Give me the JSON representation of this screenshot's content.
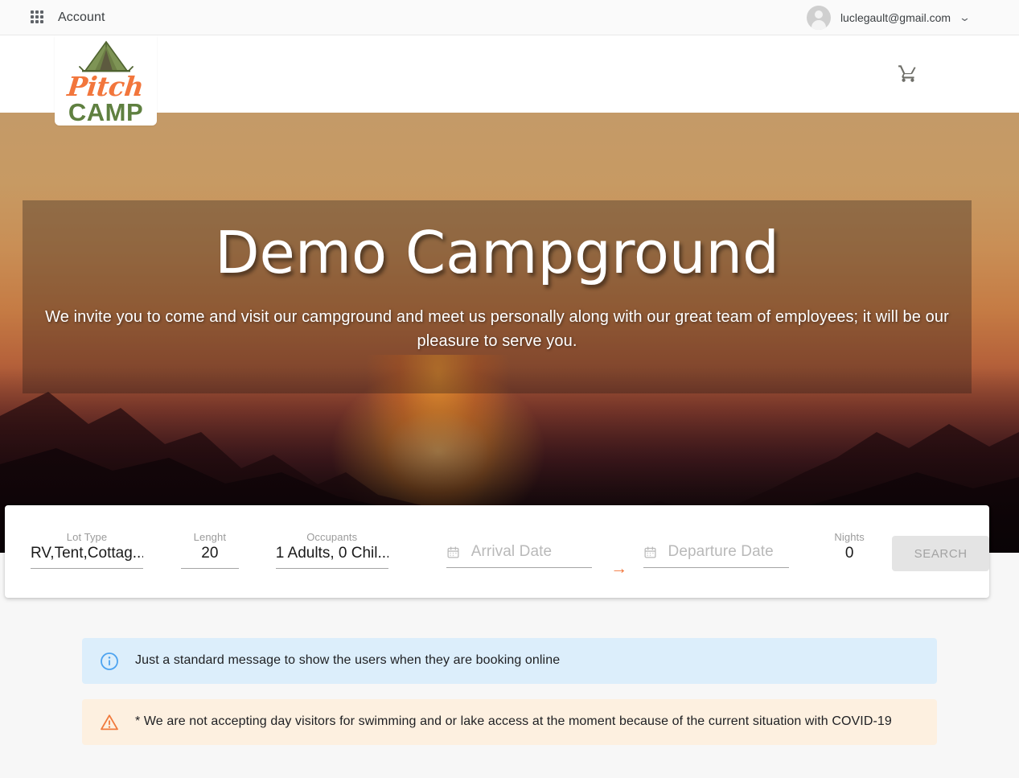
{
  "topbar": {
    "apps_icon": "apps-grid-icon",
    "account_label": "Account",
    "user_email": "luclegault@gmail.com",
    "chevron": "⌄"
  },
  "header": {
    "logo_pitch": "Pitch",
    "logo_camp": "CAMP",
    "logo_tent_icon": "tent-icon",
    "cart_icon": "shopping-cart-icon"
  },
  "hero": {
    "title": "Demo Campground",
    "subtitle": "We invite you to come and visit our campground and meet us personally along with our great team of employees; it will be our pleasure to serve you."
  },
  "search": {
    "lot_type": {
      "label": "Lot Type",
      "value": "RV,Tent,Cottag..."
    },
    "length": {
      "label": "Lenght",
      "value": "20"
    },
    "occupants": {
      "label": "Occupants",
      "value": "1 Adults, 0 Chil..."
    },
    "arrival": {
      "placeholder": "Arrival Date",
      "value": ""
    },
    "departure": {
      "placeholder": "Departure Date",
      "value": ""
    },
    "arrow": "→",
    "nights": {
      "label": "Nights",
      "value": "0"
    },
    "search_button": "SEARCH"
  },
  "alerts": [
    {
      "type": "info",
      "icon": "info-circle-icon",
      "text": "Just a standard message to show the users when they are booking online"
    },
    {
      "type": "warning",
      "icon": "warning-triangle-icon",
      "text": "* We are not accepting day visitors for swimming and or lake access at the moment because of the current situation with COVID-19"
    }
  ],
  "colors": {
    "accent_orange": "#f2763c",
    "logo_green": "#5f8040",
    "info_bg": "#dceefb",
    "info_icon": "#4da3f0",
    "warn_bg": "#fdf0e0",
    "warn_icon": "#f07a3c",
    "button_disabled_bg": "#e4e4e4",
    "button_disabled_text": "#a3a3a3"
  }
}
